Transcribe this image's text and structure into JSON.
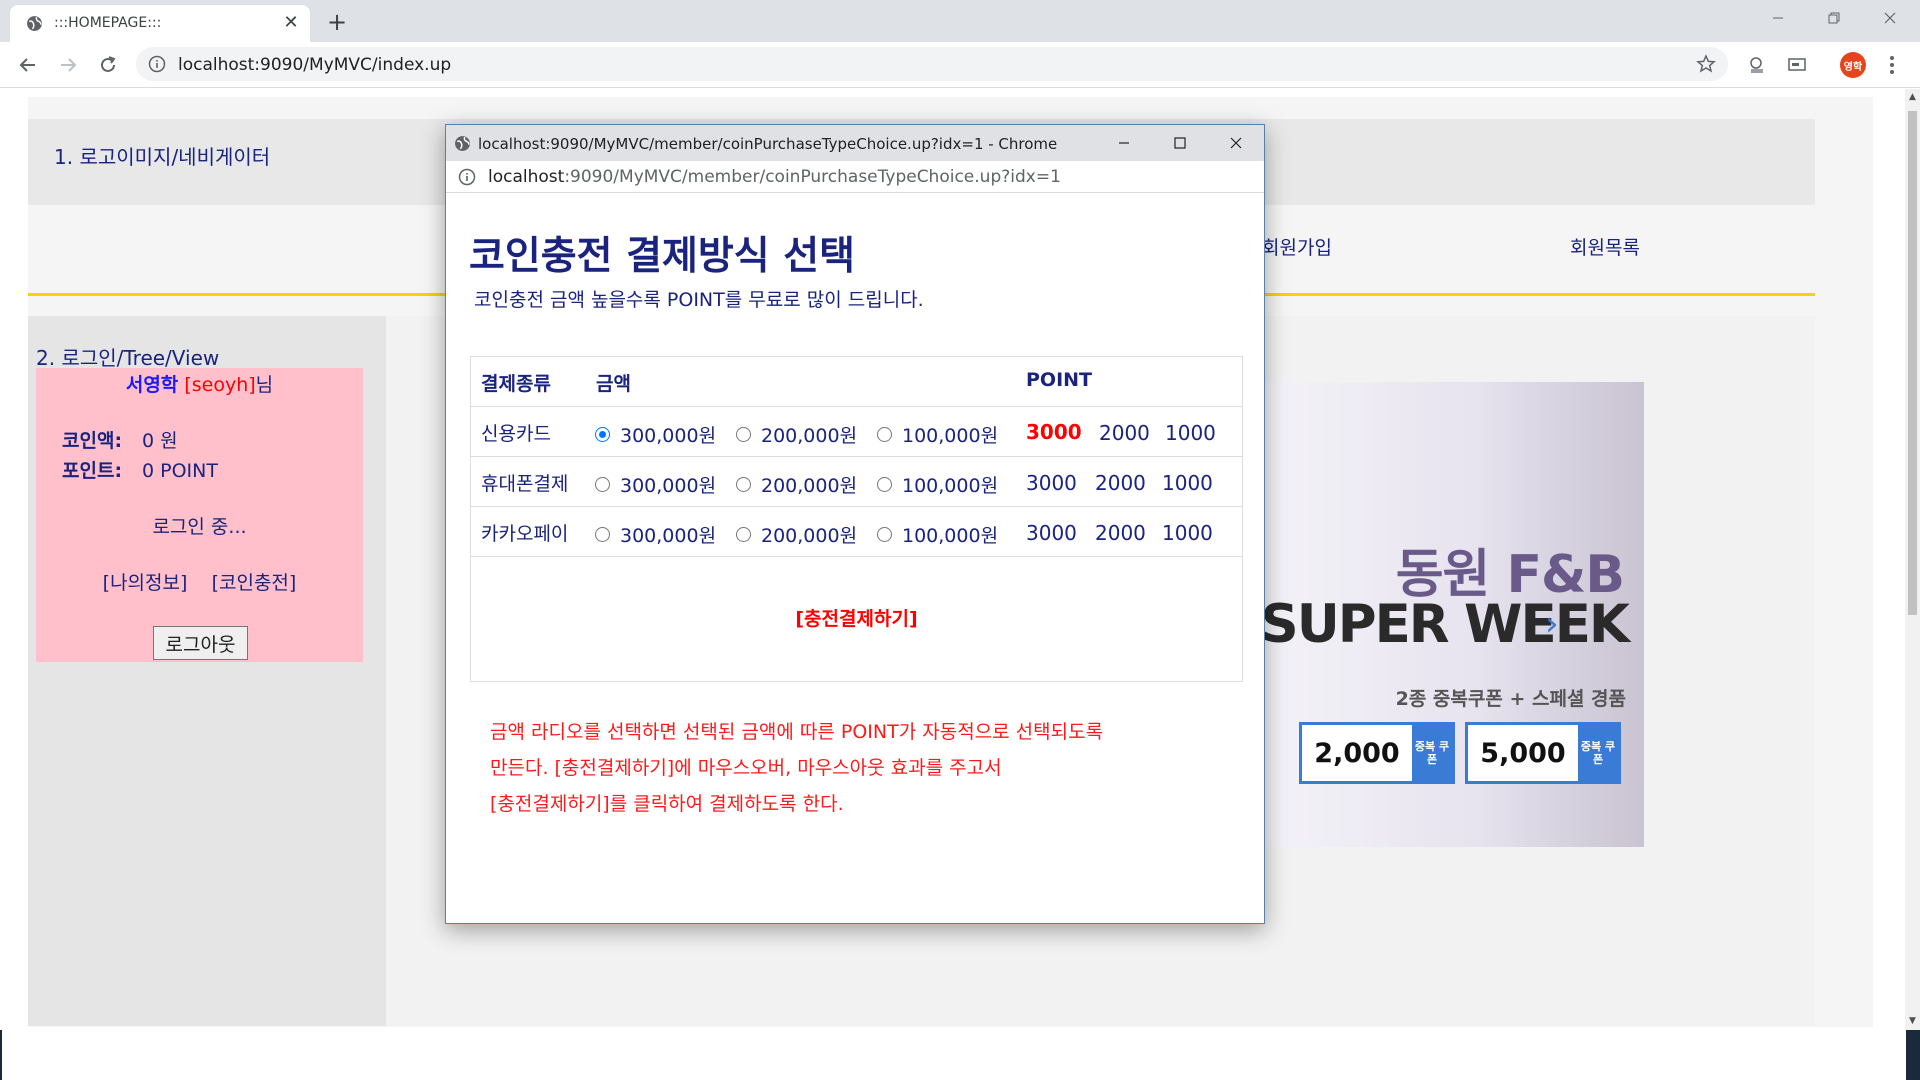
{
  "browser": {
    "tab_title": ":::HOMEPAGE:::",
    "url": "localhost:9090/MyMVC/index.up",
    "profile_initials": "영학"
  },
  "page": {
    "header1_text": "1. 로고이미지/네비게이터",
    "nav": [
      "회원가입",
      "회원목록"
    ],
    "sidebar_title": "2. 로그인/Tree/View",
    "login": {
      "name": "서영학",
      "userid": "[seoyh]",
      "suffix": "님",
      "coin_label": "코인액:",
      "coin_value": "0 원",
      "point_label": "포인트:",
      "point_value": "0 POINT",
      "status": "로그인 중...",
      "link_myinfo": "[나의정보]",
      "link_coin": "[코인충전]",
      "logout": "로그아웃"
    },
    "ad": {
      "brand": "동원 F&B",
      "headline": "SUPER WEEK",
      "sub": "2종 중복쿠폰 + 스페셜 경품",
      "coupons": [
        {
          "value": "2,000",
          "tag": "중복 쿠폰"
        },
        {
          "value": "5,000",
          "tag": "중복 쿠폰"
        }
      ]
    }
  },
  "popup": {
    "window_title": "localhost:9090/MyMVC/member/coinPurchaseTypeChoice.up?idx=1 - Chrome",
    "url_host": "localhost",
    "url_rest": ":9090/MyMVC/member/coinPurchaseTypeChoice.up?idx=1",
    "heading": "코인충전 결제방식 선택",
    "subheading": "코인충전 금액 높을수록 POINT를 무료로 많이 드립니다.",
    "table": {
      "headers": [
        "결제종류",
        "금액",
        "POINT"
      ],
      "rows": [
        {
          "type": "신용카드",
          "amounts": [
            "300,000원",
            "200,000원",
            "100,000원"
          ],
          "points": [
            "3000",
            "2000",
            "1000"
          ],
          "selected_index": 0
        },
        {
          "type": "휴대폰결제",
          "amounts": [
            "300,000원",
            "200,000원",
            "100,000원"
          ],
          "points": [
            "3000",
            "2000",
            "1000"
          ],
          "selected_index": null
        },
        {
          "type": "카카오페이",
          "amounts": [
            "300,000원",
            "200,000원",
            "100,000원"
          ],
          "points": [
            "3000",
            "2000",
            "1000"
          ],
          "selected_index": null
        }
      ],
      "pay_button": "[충전결제하기]"
    },
    "notes": [
      "금액 라디오를 선택하면 선택된 금액에 따른 POINT가 자동적으로 선택되도록",
      "만든다. [충전결제하기]에 마우스오버, 마우스아웃 효과를 주고서",
      "[충전결제하기]를 클릭하여 결제하도록 한다."
    ]
  },
  "colors": {
    "navy_text": "#1a237e",
    "accent_red": "#ff0000",
    "login_box_bg": "#ffc0cb",
    "nav_underline": "#f2d600",
    "radio_blue": "#0075ff"
  }
}
